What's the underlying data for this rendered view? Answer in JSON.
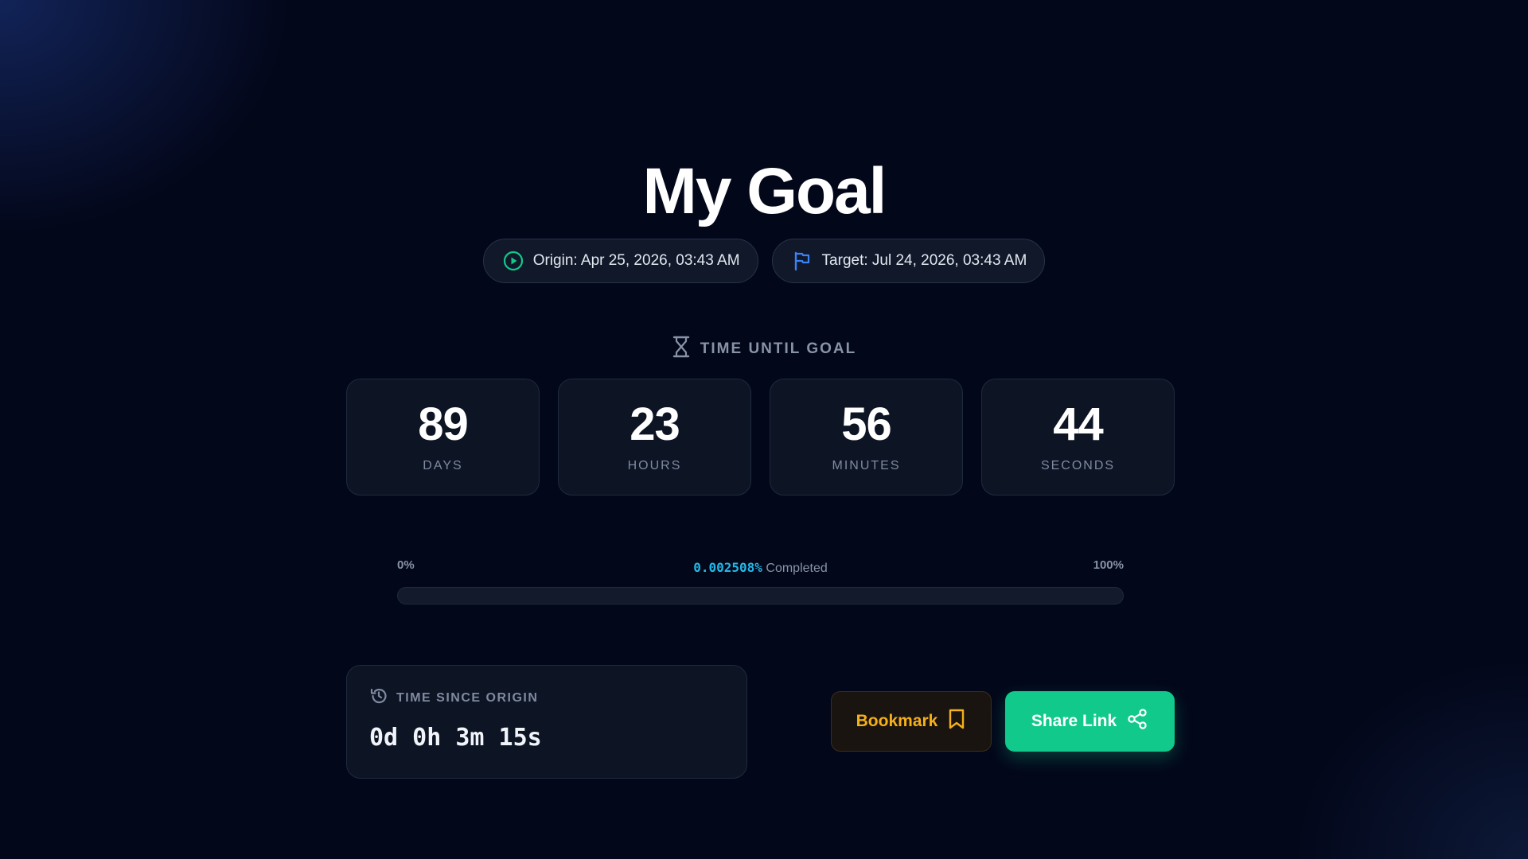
{
  "title": "My Goal",
  "origin": {
    "label": "Origin: Apr 25, 2026, 03:43 AM",
    "icon": "play-circle-icon"
  },
  "target": {
    "label": "Target: Jul 24, 2026, 03:43 AM",
    "icon": "flag-icon"
  },
  "countdown": {
    "heading": "TIME UNTIL GOAL",
    "icon": "hourglass-icon",
    "units": [
      {
        "value": "89",
        "label": "DAYS"
      },
      {
        "value": "23",
        "label": "HOURS"
      },
      {
        "value": "56",
        "label": "MINUTES"
      },
      {
        "value": "44",
        "label": "SECONDS"
      }
    ]
  },
  "progress": {
    "min_label": "0%",
    "max_label": "100%",
    "percent_text": "0.002508%",
    "suffix": "Completed",
    "percent": 0.002508
  },
  "since": {
    "heading": "TIME SINCE ORIGIN",
    "icon": "history-icon",
    "value": "0d 0h 3m 15s"
  },
  "actions": {
    "bookmark_label": "Bookmark",
    "share_label": "Share Link"
  },
  "colors": {
    "accent_green": "#10c98a",
    "accent_blue": "#3b82f6",
    "accent_cyan": "#22b8e6",
    "bookmark_amber": "#f5b01a",
    "background": "#03071a"
  }
}
